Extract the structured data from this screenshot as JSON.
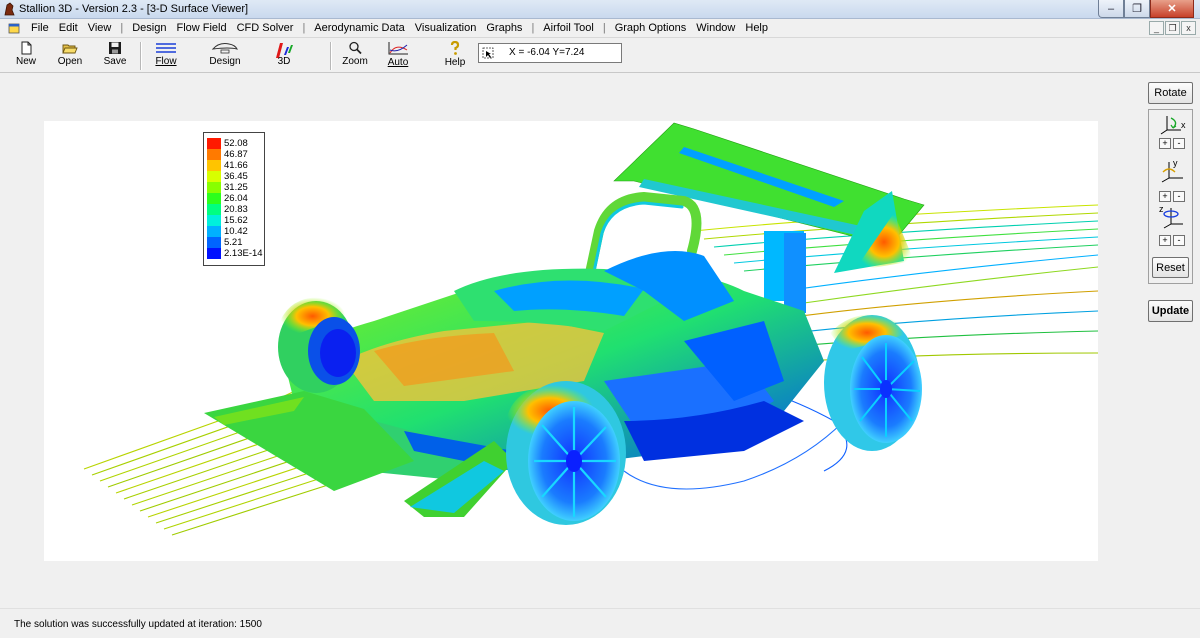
{
  "window": {
    "title": "Stallion 3D - Version 2.3 - [3-D Surface Viewer]",
    "minimize": "–",
    "maximize": "❐",
    "close": "✕"
  },
  "menu": {
    "items": [
      "File",
      "Edit",
      "View",
      "Design",
      "Flow Field",
      "CFD Solver",
      "Aerodynamic Data",
      "Visualization",
      "Graphs",
      "Airfoil Tool",
      "Graph Options",
      "Window",
      "Help"
    ],
    "separator": "|",
    "mdi_minimize": "_",
    "mdi_restore": "❐",
    "mdi_close": "x"
  },
  "toolbar": {
    "new": "New",
    "open": "Open",
    "save": "Save",
    "flow": "Flow",
    "design": "Design",
    "three_d": "3D",
    "zoom": "Zoom",
    "auto": "Auto",
    "help": "Help",
    "coords": "X = -6.04  Y=7.24"
  },
  "legend": {
    "entries": [
      {
        "label": "52.08",
        "color": "#ff1a00"
      },
      {
        "label": "46.87",
        "color": "#ff7a00"
      },
      {
        "label": "41.66",
        "color": "#ffc400"
      },
      {
        "label": "36.45",
        "color": "#d8ff00"
      },
      {
        "label": "31.25",
        "color": "#88ff00"
      },
      {
        "label": "26.04",
        "color": "#2cff1c"
      },
      {
        "label": "20.83",
        "color": "#00ff80"
      },
      {
        "label": "15.62",
        "color": "#00f0dc"
      },
      {
        "label": "10.42",
        "color": "#00b0ff"
      },
      {
        "label": "5.21",
        "color": "#0064ff"
      },
      {
        "label": "2.13E-14",
        "color": "#0010ff"
      }
    ]
  },
  "panel": {
    "rotate": "Rotate",
    "axis_x": "x",
    "axis_y": "y",
    "axis_z": "z",
    "plus": "+",
    "minus": "-",
    "reset": "Reset",
    "update": "Update"
  },
  "status": {
    "message": "The solution was successfully updated at iteration: 1500"
  }
}
